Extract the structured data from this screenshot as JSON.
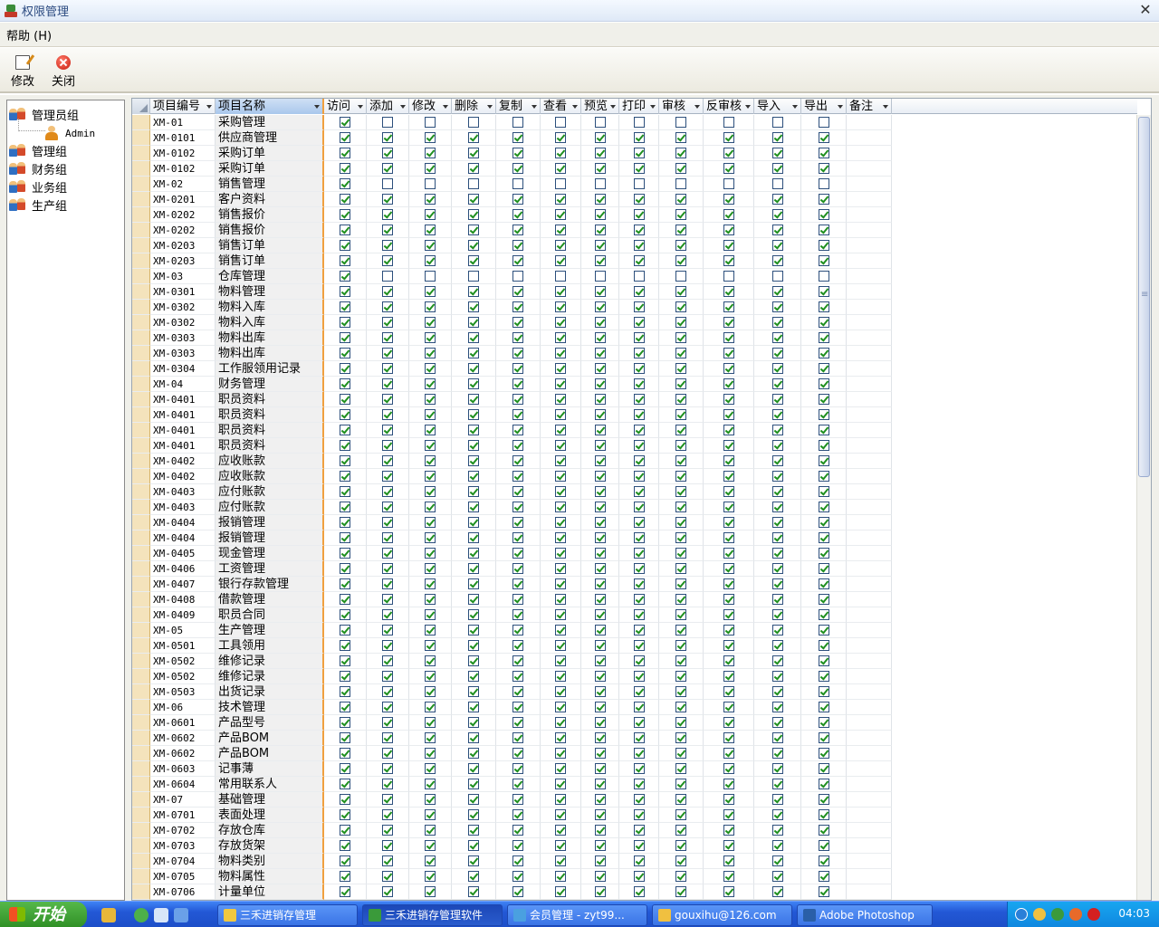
{
  "window": {
    "title": "权限管理"
  },
  "menu": {
    "help": "帮助 (H)"
  },
  "toolbar": {
    "edit_label": "修改",
    "close_label": "关闭"
  },
  "tree": {
    "nodes": [
      {
        "label": "管理员组",
        "children": [
          "Admin"
        ]
      },
      {
        "label": "管理组"
      },
      {
        "label": "财务组"
      },
      {
        "label": "业务组"
      },
      {
        "label": "生产组"
      }
    ]
  },
  "grid": {
    "columns": [
      "项目编号",
      "项目名称",
      "访问",
      "添加",
      "修改",
      "删除",
      "复制",
      "查看",
      "预览",
      "打印",
      "审核",
      "反审核",
      "导入",
      "导出",
      "备注"
    ],
    "header_display": [
      "项目编号",
      "项目名称",
      "访问",
      "添加",
      "修改",
      "删除",
      "复制",
      "查看",
      "预览",
      "打印",
      "审核",
      "反审核",
      "导入",
      "导出",
      "备注"
    ],
    "rows": [
      {
        "code": "XM-01",
        "name": "采购管理",
        "perms": [
          1,
          0,
          0,
          0,
          0,
          0,
          0,
          0,
          0,
          0,
          0,
          0
        ]
      },
      {
        "code": "XM-0101",
        "name": "供应商管理",
        "perms": [
          1,
          1,
          1,
          1,
          1,
          1,
          1,
          1,
          1,
          1,
          1,
          1
        ]
      },
      {
        "code": "XM-0102",
        "name": "采购订单",
        "perms": [
          1,
          1,
          1,
          1,
          1,
          1,
          1,
          1,
          1,
          1,
          1,
          1
        ]
      },
      {
        "code": "XM-0102",
        "name": "采购订单",
        "perms": [
          1,
          1,
          1,
          1,
          1,
          1,
          1,
          1,
          1,
          1,
          1,
          1
        ]
      },
      {
        "code": "XM-02",
        "name": "销售管理",
        "perms": [
          1,
          0,
          0,
          0,
          0,
          0,
          0,
          0,
          0,
          0,
          0,
          0
        ]
      },
      {
        "code": "XM-0201",
        "name": "客户资料",
        "perms": [
          1,
          1,
          1,
          1,
          1,
          1,
          1,
          1,
          1,
          1,
          1,
          1
        ]
      },
      {
        "code": "XM-0202",
        "name": "销售报价",
        "perms": [
          1,
          1,
          1,
          1,
          1,
          1,
          1,
          1,
          1,
          1,
          1,
          1
        ]
      },
      {
        "code": "XM-0202",
        "name": "销售报价",
        "perms": [
          1,
          1,
          1,
          1,
          1,
          1,
          1,
          1,
          1,
          1,
          1,
          1
        ]
      },
      {
        "code": "XM-0203",
        "name": "销售订单",
        "perms": [
          1,
          1,
          1,
          1,
          1,
          1,
          1,
          1,
          1,
          1,
          1,
          1
        ]
      },
      {
        "code": "XM-0203",
        "name": "销售订单",
        "perms": [
          1,
          1,
          1,
          1,
          1,
          1,
          1,
          1,
          1,
          1,
          1,
          1
        ]
      },
      {
        "code": "XM-03",
        "name": "仓库管理",
        "perms": [
          1,
          0,
          0,
          0,
          0,
          0,
          0,
          0,
          0,
          0,
          0,
          0
        ]
      },
      {
        "code": "XM-0301",
        "name": "物料管理",
        "perms": [
          1,
          1,
          1,
          1,
          1,
          1,
          1,
          1,
          1,
          1,
          1,
          1
        ]
      },
      {
        "code": "XM-0302",
        "name": "物料入库",
        "perms": [
          1,
          1,
          1,
          1,
          1,
          1,
          1,
          1,
          1,
          1,
          1,
          1
        ]
      },
      {
        "code": "XM-0302",
        "name": "物料入库",
        "perms": [
          1,
          1,
          1,
          1,
          1,
          1,
          1,
          1,
          1,
          1,
          1,
          1
        ]
      },
      {
        "code": "XM-0303",
        "name": "物料出库",
        "perms": [
          1,
          1,
          1,
          1,
          1,
          1,
          1,
          1,
          1,
          1,
          1,
          1
        ]
      },
      {
        "code": "XM-0303",
        "name": "物料出库",
        "perms": [
          1,
          1,
          1,
          1,
          1,
          1,
          1,
          1,
          1,
          1,
          1,
          1
        ]
      },
      {
        "code": "XM-0304",
        "name": "工作服领用记录",
        "perms": [
          1,
          1,
          1,
          1,
          1,
          1,
          1,
          1,
          1,
          1,
          1,
          1
        ]
      },
      {
        "code": "XM-04",
        "name": "财务管理",
        "perms": [
          1,
          1,
          1,
          1,
          1,
          1,
          1,
          1,
          1,
          1,
          1,
          1
        ]
      },
      {
        "code": "XM-0401",
        "name": "职员资料",
        "perms": [
          1,
          1,
          1,
          1,
          1,
          1,
          1,
          1,
          1,
          1,
          1,
          1
        ]
      },
      {
        "code": "XM-0401",
        "name": "职员资料",
        "perms": [
          1,
          1,
          1,
          1,
          1,
          1,
          1,
          1,
          1,
          1,
          1,
          1
        ]
      },
      {
        "code": "XM-0401",
        "name": "职员资料",
        "perms": [
          1,
          1,
          1,
          1,
          1,
          1,
          1,
          1,
          1,
          1,
          1,
          1
        ]
      },
      {
        "code": "XM-0401",
        "name": "职员资料",
        "perms": [
          1,
          1,
          1,
          1,
          1,
          1,
          1,
          1,
          1,
          1,
          1,
          1
        ]
      },
      {
        "code": "XM-0402",
        "name": "应收账款",
        "perms": [
          1,
          1,
          1,
          1,
          1,
          1,
          1,
          1,
          1,
          1,
          1,
          1
        ]
      },
      {
        "code": "XM-0402",
        "name": "应收账款",
        "perms": [
          1,
          1,
          1,
          1,
          1,
          1,
          1,
          1,
          1,
          1,
          1,
          1
        ]
      },
      {
        "code": "XM-0403",
        "name": "应付账款",
        "perms": [
          1,
          1,
          1,
          1,
          1,
          1,
          1,
          1,
          1,
          1,
          1,
          1
        ]
      },
      {
        "code": "XM-0403",
        "name": "应付账款",
        "perms": [
          1,
          1,
          1,
          1,
          1,
          1,
          1,
          1,
          1,
          1,
          1,
          1
        ]
      },
      {
        "code": "XM-0404",
        "name": "报销管理",
        "perms": [
          1,
          1,
          1,
          1,
          1,
          1,
          1,
          1,
          1,
          1,
          1,
          1
        ]
      },
      {
        "code": "XM-0404",
        "name": "报销管理",
        "perms": [
          1,
          1,
          1,
          1,
          1,
          1,
          1,
          1,
          1,
          1,
          1,
          1
        ]
      },
      {
        "code": "XM-0405",
        "name": "现金管理",
        "perms": [
          1,
          1,
          1,
          1,
          1,
          1,
          1,
          1,
          1,
          1,
          1,
          1
        ]
      },
      {
        "code": "XM-0406",
        "name": "工资管理",
        "perms": [
          1,
          1,
          1,
          1,
          1,
          1,
          1,
          1,
          1,
          1,
          1,
          1
        ]
      },
      {
        "code": "XM-0407",
        "name": "银行存款管理",
        "perms": [
          1,
          1,
          1,
          1,
          1,
          1,
          1,
          1,
          1,
          1,
          1,
          1
        ]
      },
      {
        "code": "XM-0408",
        "name": "借款管理",
        "perms": [
          1,
          1,
          1,
          1,
          1,
          1,
          1,
          1,
          1,
          1,
          1,
          1
        ]
      },
      {
        "code": "XM-0409",
        "name": "职员合同",
        "perms": [
          1,
          1,
          1,
          1,
          1,
          1,
          1,
          1,
          1,
          1,
          1,
          1
        ]
      },
      {
        "code": "XM-05",
        "name": "生产管理",
        "perms": [
          1,
          1,
          1,
          1,
          1,
          1,
          1,
          1,
          1,
          1,
          1,
          1
        ]
      },
      {
        "code": "XM-0501",
        "name": "工具领用",
        "perms": [
          1,
          1,
          1,
          1,
          1,
          1,
          1,
          1,
          1,
          1,
          1,
          1
        ]
      },
      {
        "code": "XM-0502",
        "name": "维修记录",
        "perms": [
          1,
          1,
          1,
          1,
          1,
          1,
          1,
          1,
          1,
          1,
          1,
          1
        ]
      },
      {
        "code": "XM-0502",
        "name": "维修记录",
        "perms": [
          1,
          1,
          1,
          1,
          1,
          1,
          1,
          1,
          1,
          1,
          1,
          1
        ]
      },
      {
        "code": "XM-0503",
        "name": "出货记录",
        "perms": [
          1,
          1,
          1,
          1,
          1,
          1,
          1,
          1,
          1,
          1,
          1,
          1
        ]
      },
      {
        "code": "XM-06",
        "name": "技术管理",
        "perms": [
          1,
          1,
          1,
          1,
          1,
          1,
          1,
          1,
          1,
          1,
          1,
          1
        ]
      },
      {
        "code": "XM-0601",
        "name": "产品型号",
        "perms": [
          1,
          1,
          1,
          1,
          1,
          1,
          1,
          1,
          1,
          1,
          1,
          1
        ]
      },
      {
        "code": "XM-0602",
        "name": "产品BOM",
        "perms": [
          1,
          1,
          1,
          1,
          1,
          1,
          1,
          1,
          1,
          1,
          1,
          1
        ]
      },
      {
        "code": "XM-0602",
        "name": "产品BOM",
        "perms": [
          1,
          1,
          1,
          1,
          1,
          1,
          1,
          1,
          1,
          1,
          1,
          1
        ]
      },
      {
        "code": "XM-0603",
        "name": "记事薄",
        "perms": [
          1,
          1,
          1,
          1,
          1,
          1,
          1,
          1,
          1,
          1,
          1,
          1
        ]
      },
      {
        "code": "XM-0604",
        "name": "常用联系人",
        "perms": [
          1,
          1,
          1,
          1,
          1,
          1,
          1,
          1,
          1,
          1,
          1,
          1
        ]
      },
      {
        "code": "XM-07",
        "name": "基础管理",
        "perms": [
          1,
          1,
          1,
          1,
          1,
          1,
          1,
          1,
          1,
          1,
          1,
          1
        ]
      },
      {
        "code": "XM-0701",
        "name": "表面处理",
        "perms": [
          1,
          1,
          1,
          1,
          1,
          1,
          1,
          1,
          1,
          1,
          1,
          1
        ]
      },
      {
        "code": "XM-0702",
        "name": "存放仓库",
        "perms": [
          1,
          1,
          1,
          1,
          1,
          1,
          1,
          1,
          1,
          1,
          1,
          1
        ]
      },
      {
        "code": "XM-0703",
        "name": "存放货架",
        "perms": [
          1,
          1,
          1,
          1,
          1,
          1,
          1,
          1,
          1,
          1,
          1,
          1
        ]
      },
      {
        "code": "XM-0704",
        "name": "物料类别",
        "perms": [
          1,
          1,
          1,
          1,
          1,
          1,
          1,
          1,
          1,
          1,
          1,
          1
        ]
      },
      {
        "code": "XM-0705",
        "name": "物料属性",
        "perms": [
          1,
          1,
          1,
          1,
          1,
          1,
          1,
          1,
          1,
          1,
          1,
          1
        ]
      },
      {
        "code": "XM-0706",
        "name": "计量单位",
        "perms": [
          1,
          1,
          1,
          1,
          1,
          1,
          1,
          1,
          1,
          1,
          1,
          1
        ]
      }
    ]
  },
  "taskbar": {
    "start_label": "开始",
    "tasks": [
      {
        "label": "三禾进销存管理",
        "icon": "folder-icon"
      },
      {
        "label": "三禾进销存管理软件",
        "icon": "app-icon",
        "active": true
      },
      {
        "label": "会员管理 - zyt99...",
        "icon": "ie-icon"
      },
      {
        "label": "gouxihu@126.com",
        "icon": "mail-icon"
      },
      {
        "label": "Adobe Photoshop",
        "icon": "photoshop-icon"
      }
    ],
    "clock": "04:03"
  }
}
